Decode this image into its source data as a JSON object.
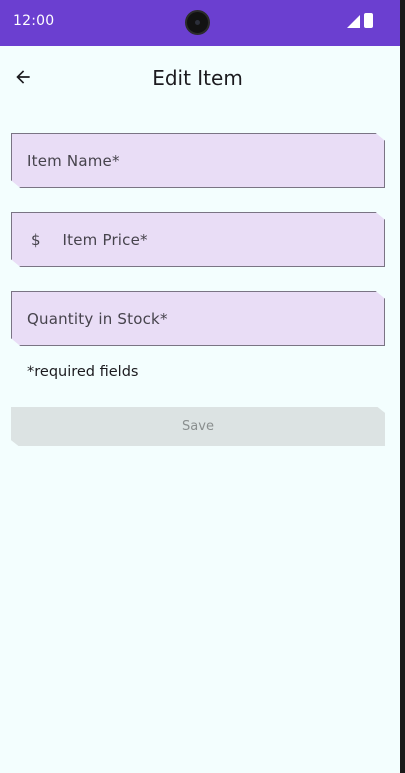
{
  "status_bar": {
    "time": "12:00",
    "icons": [
      "camera-cutout",
      "signal-icon",
      "battery-icon"
    ]
  },
  "top_bar": {
    "back_icon": "arrow-back-icon",
    "title": "Edit Item"
  },
  "form": {
    "item_name": {
      "placeholder": "Item Name*",
      "value": ""
    },
    "item_price": {
      "prefix": "$",
      "placeholder": "Item Price*",
      "value": ""
    },
    "quantity": {
      "placeholder": "Quantity in Stock*",
      "value": ""
    },
    "required_note": "*required fields",
    "save_label": "Save",
    "save_enabled": false
  },
  "colors": {
    "status_bar": "#6b3fd0",
    "background": "#f3fefe",
    "field_fill": "#e9ddf6",
    "field_border": "#7a7484",
    "button_disabled_fill": "#dce3e3",
    "button_disabled_text": "#8a8f8f"
  }
}
